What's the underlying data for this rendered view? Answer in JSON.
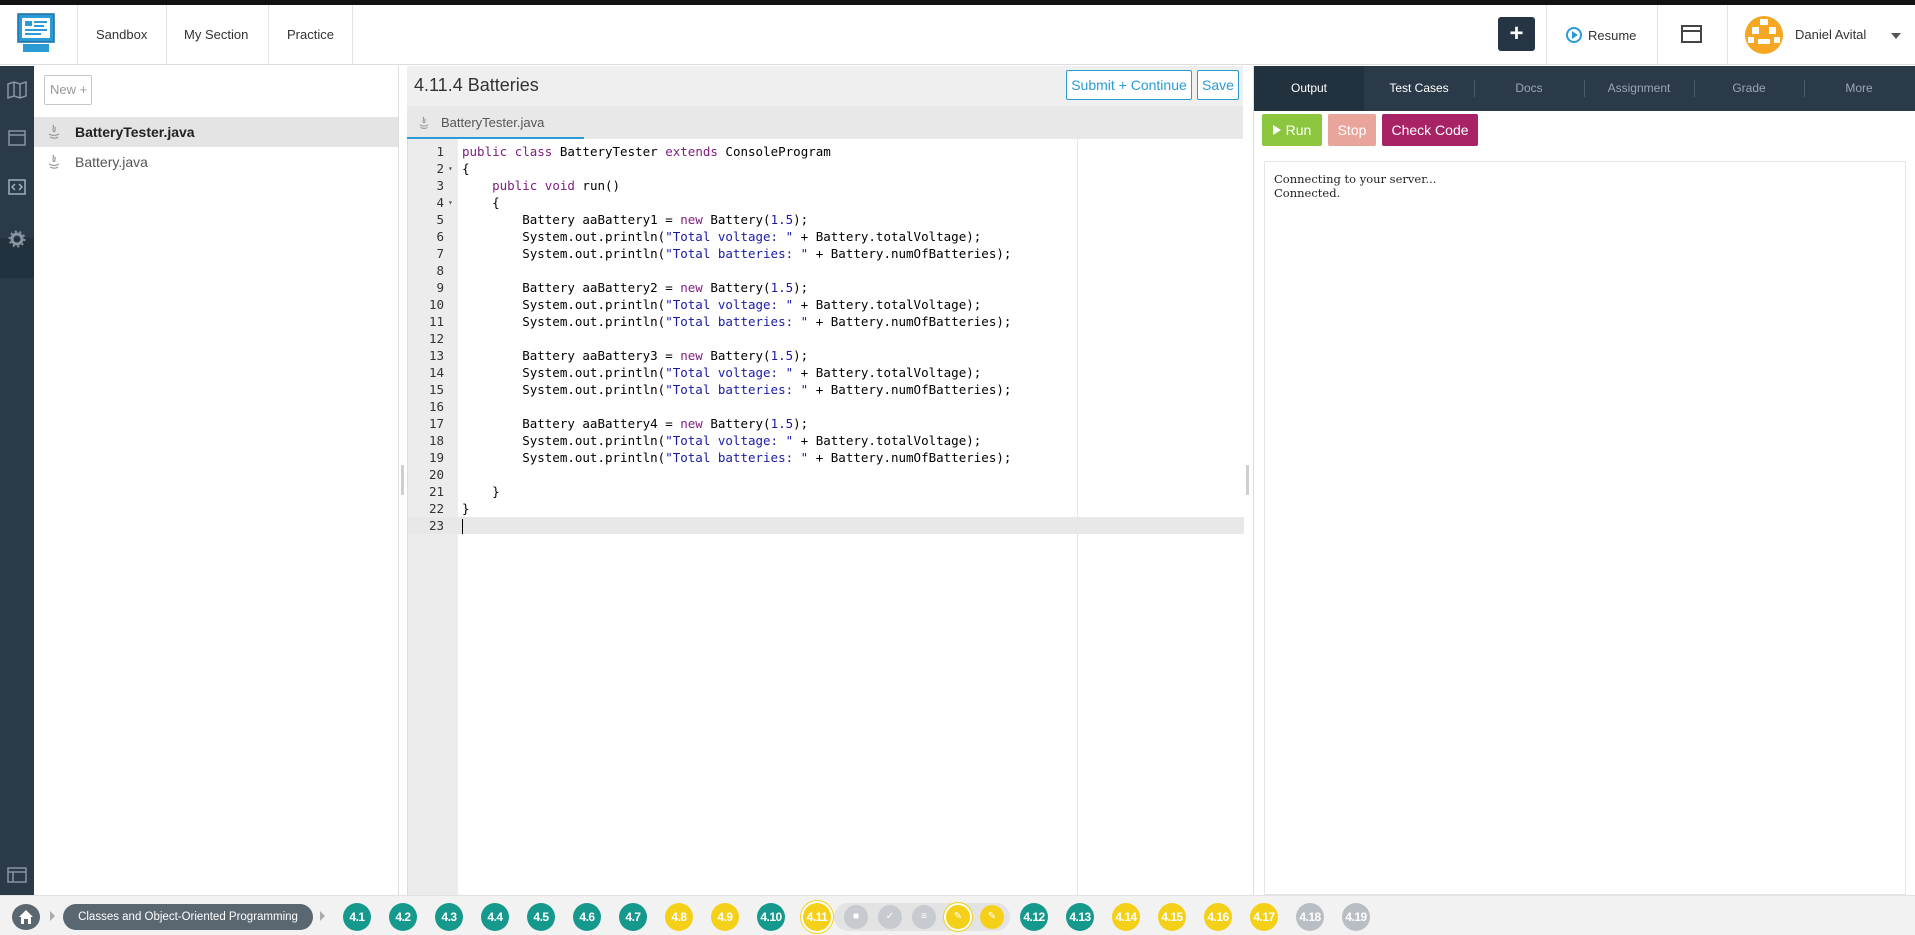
{
  "nav": {
    "links": [
      "Sandbox",
      "My Section",
      "Practice"
    ],
    "add_label": "+",
    "resume_label": "Resume",
    "user_name": "Daniel Avital"
  },
  "files": {
    "new_label": "New +",
    "items": [
      {
        "name": "BatteryTester.java",
        "selected": true
      },
      {
        "name": "Battery.java",
        "selected": false
      }
    ]
  },
  "editor": {
    "title": "4.11.4 Batteries",
    "submit_label": "Submit + Continue",
    "save_label": "Save",
    "tab_label": "BatteryTester.java",
    "line_numbers": [
      "1",
      "2",
      "3",
      "4",
      "5",
      "6",
      "7",
      "8",
      "9",
      "10",
      "11",
      "12",
      "13",
      "14",
      "15",
      "16",
      "17",
      "18",
      "19",
      "20",
      "21",
      "22",
      "23"
    ],
    "code_lines": [
      "public class BatteryTester extends ConsoleProgram",
      "{",
      "    public void run()",
      "    {",
      "        Battery aaBattery1 = new Battery(1.5);",
      "        System.out.println(\"Total voltage: \" + Battery.totalVoltage);",
      "        System.out.println(\"Total batteries: \" + Battery.numOfBatteries);",
      "",
      "        Battery aaBattery2 = new Battery(1.5);",
      "        System.out.println(\"Total voltage: \" + Battery.totalVoltage);",
      "        System.out.println(\"Total batteries: \" + Battery.numOfBatteries);",
      "",
      "        Battery aaBattery3 = new Battery(1.5);",
      "        System.out.println(\"Total voltage: \" + Battery.totalVoltage);",
      "        System.out.println(\"Total batteries: \" + Battery.numOfBatteries);",
      "",
      "        Battery aaBattery4 = new Battery(1.5);",
      "        System.out.println(\"Total voltage: \" + Battery.totalVoltage);",
      "        System.out.println(\"Total batteries: \" + Battery.numOfBatteries);",
      "",
      "    }",
      "}",
      ""
    ]
  },
  "right": {
    "tabs": [
      "Output",
      "Test Cases",
      "Docs",
      "Assignment",
      "Grade",
      "More"
    ],
    "active_tab": "Output",
    "run_label": "Run",
    "stop_label": "Stop",
    "check_label": "Check Code",
    "console_lines": [
      "Connecting to your server...",
      "Connected."
    ]
  },
  "bottom": {
    "breadcrumb": "Classes and Object-Oriented Programming",
    "units_before": [
      {
        "label": "4.1",
        "status": "teal"
      },
      {
        "label": "4.2",
        "status": "teal"
      },
      {
        "label": "4.3",
        "status": "teal"
      },
      {
        "label": "4.4",
        "status": "teal"
      },
      {
        "label": "4.5",
        "status": "teal"
      },
      {
        "label": "4.6",
        "status": "teal"
      },
      {
        "label": "4.7",
        "status": "teal"
      },
      {
        "label": "4.8",
        "status": "yellow"
      },
      {
        "label": "4.9",
        "status": "yellow"
      },
      {
        "label": "4.10",
        "status": "teal"
      },
      {
        "label": "4.11",
        "status": "yellow"
      }
    ],
    "sub_icons": [
      "video-icon",
      "check-icon",
      "doc-icon",
      "pencil-icon",
      "pencil-icon"
    ],
    "units_after": [
      {
        "label": "4.12",
        "status": "teal"
      },
      {
        "label": "4.13",
        "status": "teal"
      },
      {
        "label": "4.14",
        "status": "yellow"
      },
      {
        "label": "4.15",
        "status": "yellow"
      },
      {
        "label": "4.16",
        "status": "yellow"
      },
      {
        "label": "4.17",
        "status": "yellow"
      },
      {
        "label": "4.18",
        "status": "gray"
      },
      {
        "label": "4.19",
        "status": "gray"
      }
    ]
  },
  "colors": {
    "accent": "#2b9bd6",
    "rail": "#2b3a48",
    "run": "#8cc63f",
    "stop": "#e9a49b",
    "check": "#a82266",
    "teal": "#15998c",
    "yellow": "#f5d019"
  }
}
